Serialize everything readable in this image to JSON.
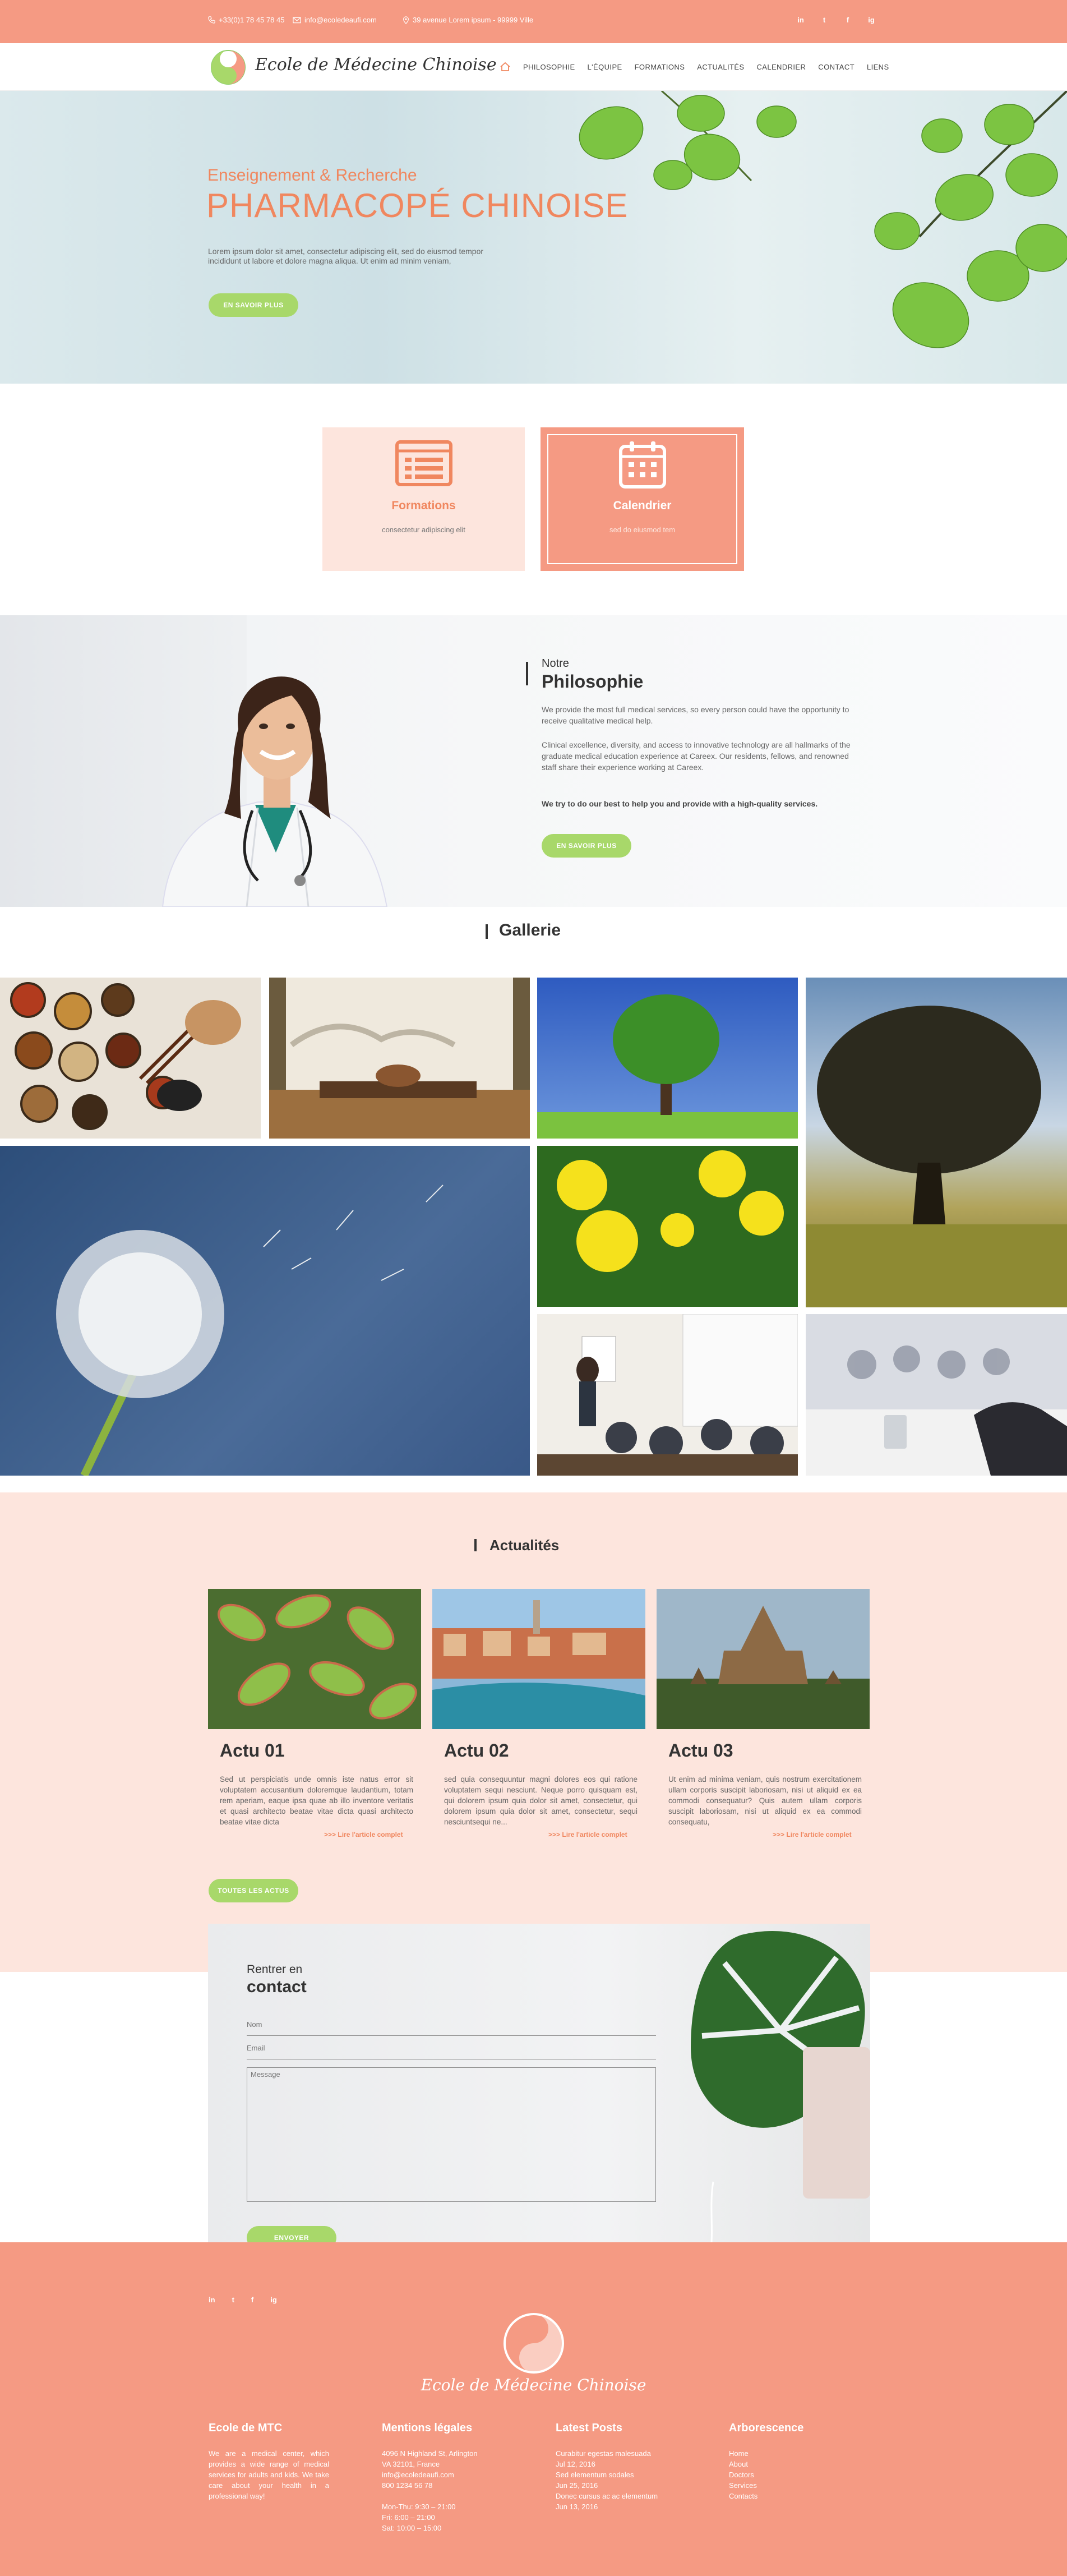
{
  "topbar": {
    "phone": "+33(0)1 78 45 78 45",
    "email": "info@ecoledeaufi.com",
    "address": "39 avenue Lorem ipsum - 99999 Ville",
    "social": [
      "in",
      "t",
      "f",
      "ig"
    ]
  },
  "brand": {
    "name": "Ecole de Médecine Chinoise"
  },
  "nav": {
    "home_icon": "home-icon",
    "items": [
      "PHILOSOPHIE",
      "L'ÉQUIPE",
      "FORMATIONS",
      "ACTUALITÉS",
      "CALENDRIER",
      "CONTACT",
      "LIENS"
    ]
  },
  "hero": {
    "subtitle": "Enseignement & Recherche",
    "title": "PHARMACOPÉ CHINOISE",
    "text": "Lorem ipsum dolor sit amet, consectetur adipiscing elit, sed do eiusmod tempor incididunt ut labore et dolore magna aliqua. Ut enim ad minim veniam,",
    "button": "EN SAVOIR PLUS"
  },
  "features": [
    {
      "title": "Formations",
      "text": "consectetur adipiscing elit",
      "icon": "browser-list-icon"
    },
    {
      "title": "Calendrier",
      "text": "sed do eiusmod tem",
      "icon": "calendar-icon"
    }
  ],
  "philosophy": {
    "kicker": "Notre",
    "title": "Philosophie",
    "p1": "We provide the most full medical services, so every person could have the opportunity to receive qualitative medical help.",
    "p2": "Clinical excellence, diversity, and access to innovative technology are all hallmarks of the graduate medical education experience at Careex. Our residents, fellows, and renowned staff share their experience working at Careex.",
    "p3": "We try to do our best to help you and provide with a high-quality services.",
    "button": "EN SAVOIR PLUS"
  },
  "gallery": {
    "title": "Gallerie"
  },
  "news": {
    "title": "Actualités",
    "button": "TOUTES LES ACTUS",
    "items": [
      {
        "title": "Actu 01",
        "text": "Sed ut perspiciatis unde omnis iste natus error sit voluptatem accusantium doloremque laudantium, totam rem aperiam, eaque ipsa quae ab illo inventore veritatis et quasi architecto beatae vitae dicta quasi architecto beatae vitae dicta",
        "link": ">>> Lire l'article complet"
      },
      {
        "title": "Actu 02",
        "text": "sed quia consequuntur magni dolores eos qui ratione voluptatem sequi nesciunt. Neque porro quisquam est, qui dolorem ipsum quia dolor sit amet, consectetur, qui dolorem ipsum quia dolor sit amet, consectetur, sequi nesciuntsequi ne...",
        "link": ">>> Lire l'article complet"
      },
      {
        "title": "Actu 03",
        "text": "Ut enim ad minima veniam, quis nostrum exercitationem ullam corporis suscipit laboriosam, nisi ut aliquid ex ea commodi consequatur? Quis autem ullam corporis suscipit laboriosam, nisi ut aliquid ex ea commodi consequatu,",
        "link": ">>> Lire l'article complet"
      }
    ]
  },
  "contact": {
    "kicker": "Rentrer en",
    "title": "contact",
    "name_placeholder": "Nom",
    "email_placeholder": "Email",
    "message_placeholder": "Message",
    "button": "ENVOYER"
  },
  "footer": {
    "social": [
      "in",
      "t",
      "f",
      "ig"
    ],
    "brand": "Ecole de Médecine Chinoise",
    "col1": {
      "title": "Ecole de MTC",
      "text": "We are a medical center, which provides a wide range of medical services for adults and kids. We take care about your health in a professional way!"
    },
    "col2": {
      "title": "Mentions légales",
      "lines": [
        "4096 N Highland St, Arlington",
        "VA 32101, France",
        "info@ecoledeaufi.com",
        "800 1234 56 78",
        "",
        "Mon-Thu: 9:30 – 21:00",
        "Fri: 6:00 – 21:00",
        "Sat: 10:00 – 15:00"
      ]
    },
    "col3": {
      "title": "Latest Posts",
      "lines": [
        "Curabitur egestas malesuada",
        "Jul 12, 2016",
        "Sed elementum sodales",
        "Jun 25, 2016",
        "Donec cursus ac ac elementum",
        "Jun 13, 2016"
      ]
    },
    "col4": {
      "title": "Arborescence",
      "lines": [
        "Home",
        "About",
        "Doctors",
        "Services",
        "Contacts"
      ]
    }
  },
  "colors": {
    "salmon": "#f59a83",
    "pale": "#fde5dd",
    "accent": "#f0875f",
    "green": "#a8d86a"
  }
}
